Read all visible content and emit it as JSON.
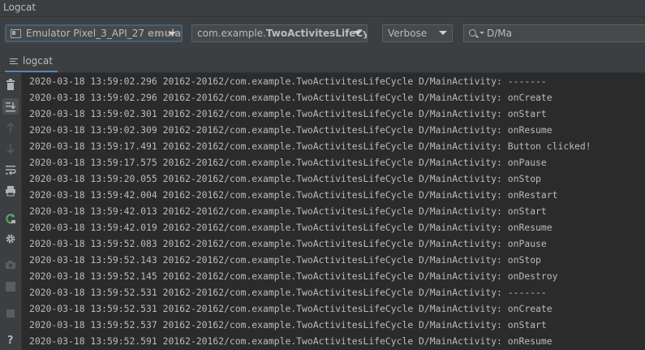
{
  "window": {
    "title": "Logcat"
  },
  "toolbar": {
    "device": {
      "name": "Emulator Pixel_3_API_27",
      "suffix": "emulat"
    },
    "process": {
      "prefix": "com.example.",
      "bold": "TwoActivitesLifeCyc"
    },
    "level": "Verbose",
    "search": {
      "value": "D/Ma"
    }
  },
  "tab": {
    "label": "logcat"
  },
  "sidebar_icons": [
    "trash-icon",
    "scroll-to-end-icon",
    "up-arrow-icon",
    "down-arrow-icon",
    "soft-wrap-icon",
    "print-icon",
    "restart-icon",
    "gear-icon",
    "camera-icon",
    "screen-record-icon",
    "stop-icon",
    "help-icon"
  ],
  "log_lines": [
    "2020-03-18 13:59:02.296 20162-20162/com.example.TwoActivitesLifeCycle D/MainActivity: -------",
    "2020-03-18 13:59:02.296 20162-20162/com.example.TwoActivitesLifeCycle D/MainActivity: onCreate",
    "2020-03-18 13:59:02.301 20162-20162/com.example.TwoActivitesLifeCycle D/MainActivity: onStart",
    "2020-03-18 13:59:02.309 20162-20162/com.example.TwoActivitesLifeCycle D/MainActivity: onResume",
    "2020-03-18 13:59:17.491 20162-20162/com.example.TwoActivitesLifeCycle D/MainActivity: Button clicked!",
    "2020-03-18 13:59:17.575 20162-20162/com.example.TwoActivitesLifeCycle D/MainActivity: onPause",
    "2020-03-18 13:59:20.055 20162-20162/com.example.TwoActivitesLifeCycle D/MainActivity: onStop",
    "2020-03-18 13:59:42.004 20162-20162/com.example.TwoActivitesLifeCycle D/MainActivity: onRestart",
    "2020-03-18 13:59:42.013 20162-20162/com.example.TwoActivitesLifeCycle D/MainActivity: onStart",
    "2020-03-18 13:59:42.019 20162-20162/com.example.TwoActivitesLifeCycle D/MainActivity: onResume",
    "2020-03-18 13:59:52.083 20162-20162/com.example.TwoActivitesLifeCycle D/MainActivity: onPause",
    "2020-03-18 13:59:52.143 20162-20162/com.example.TwoActivitesLifeCycle D/MainActivity: onStop",
    "2020-03-18 13:59:52.145 20162-20162/com.example.TwoActivitesLifeCycle D/MainActivity: onDestroy",
    "2020-03-18 13:59:52.531 20162-20162/com.example.TwoActivitesLifeCycle D/MainActivity: -------",
    "2020-03-18 13:59:52.531 20162-20162/com.example.TwoActivitesLifeCycle D/MainActivity: onCreate",
    "2020-03-18 13:59:52.537 20162-20162/com.example.TwoActivitesLifeCycle D/MainActivity: onStart",
    "2020-03-18 13:59:52.591 20162-20162/com.example.TwoActivitesLifeCycle D/MainActivity: onResume"
  ],
  "colors": {
    "background": "#2b2b2b",
    "panel": "#3c3f41",
    "text": "#bbbbbb",
    "focus": "#3d6185",
    "restart_icon": "#59a869"
  }
}
